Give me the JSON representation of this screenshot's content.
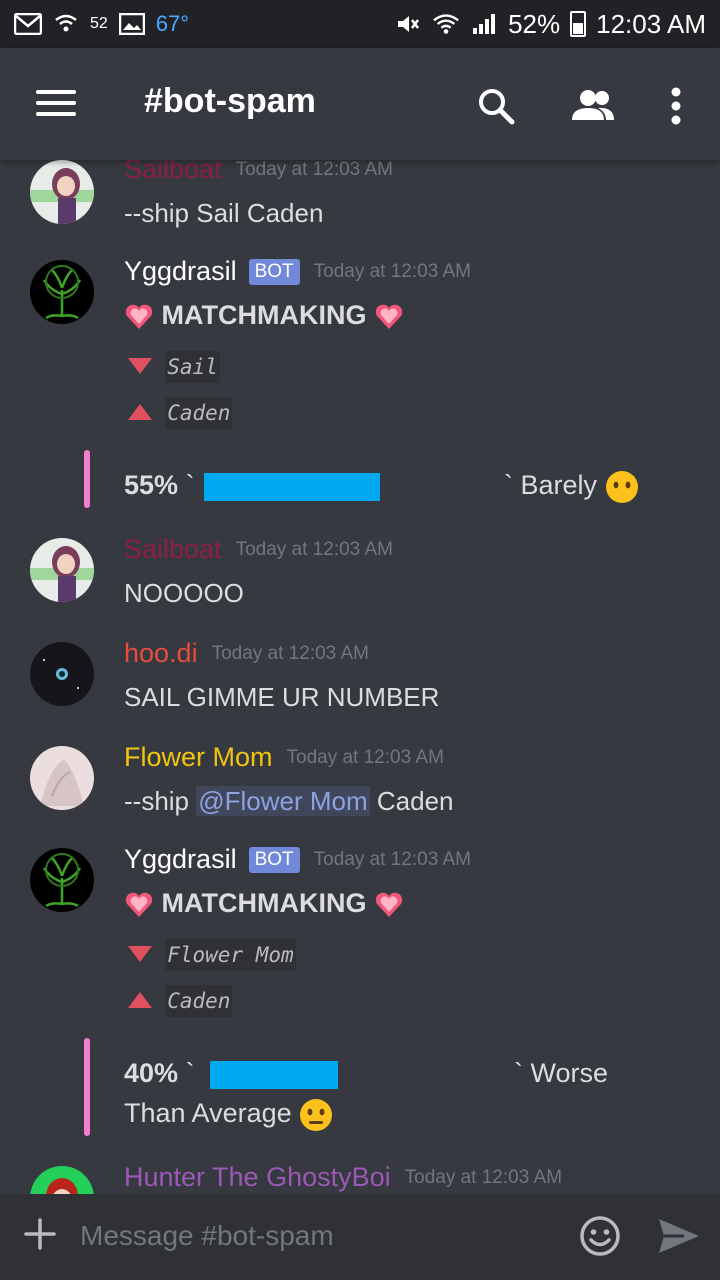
{
  "status_bar": {
    "notif_count": "52",
    "temperature": "67°",
    "battery_percent": "52%",
    "time": "12:03 AM"
  },
  "app_bar": {
    "channel": "#bot-spam"
  },
  "messages": [
    {
      "author": "Sailboat",
      "author_color": "#8b1f44",
      "timestamp": "Today at 12:03 AM",
      "text": "--ship Sail Caden"
    },
    {
      "author": "Yggdrasil",
      "author_color": "#ffffff",
      "bot_tag": "BOT",
      "timestamp": "Today at 12:03 AM",
      "title": "MATCHMAKING",
      "down_name": "Sail",
      "up_name": "Caden",
      "embed": {
        "percent": "55%",
        "tick_open": "`",
        "tick_close": "`",
        "verdict": "Barely",
        "fill": 0.55
      }
    },
    {
      "author": "Sailboat",
      "author_color": "#8b1f44",
      "timestamp": "Today at 12:03 AM",
      "text": "NOOOOO"
    },
    {
      "author": "hoo.di",
      "author_color": "#e74c3c",
      "timestamp": "Today at 12:03 AM",
      "text": "SAIL GIMME UR NUMBER"
    },
    {
      "author": "Flower Mom",
      "author_color": "#f1c40f",
      "timestamp": "Today at 12:03 AM",
      "text_before": "--ship ",
      "mention": "@Flower Mom",
      "text_after": " Caden"
    },
    {
      "author": "Yggdrasil",
      "author_color": "#ffffff",
      "bot_tag": "BOT",
      "timestamp": "Today at 12:03 AM",
      "title": "MATCHMAKING",
      "down_name": "Flower Mom",
      "up_name": "Caden",
      "embed": {
        "percent": "40%",
        "tick_open": "`",
        "tick_close": "`",
        "verdict": "Worse",
        "verdict_line2": "Than Average",
        "fill": 0.4
      }
    },
    {
      "author": "Hunter The GhostyBoi",
      "author_color": "#9b59b6",
      "timestamp": "Today at 12:03 AM"
    }
  ],
  "input": {
    "placeholder": "Message #bot-spam"
  },
  "icons": {
    "status": [
      "gmail-icon",
      "wifi-call-icon",
      "avatar-notification-icon",
      "image-icon",
      "mute-icon",
      "wifi-icon",
      "signal-icon",
      "battery-icon"
    ],
    "app_bar": [
      "menu-icon",
      "search-icon",
      "members-icon",
      "more-vert-icon"
    ],
    "input": [
      "plus-icon",
      "emoji-icon",
      "send-icon"
    ]
  },
  "colors": {
    "background": "#36393f",
    "status_bar": "#202225",
    "accent_bot": "#7289da",
    "embed_bar": "#f47fd1",
    "progress": "#00a8f0"
  }
}
